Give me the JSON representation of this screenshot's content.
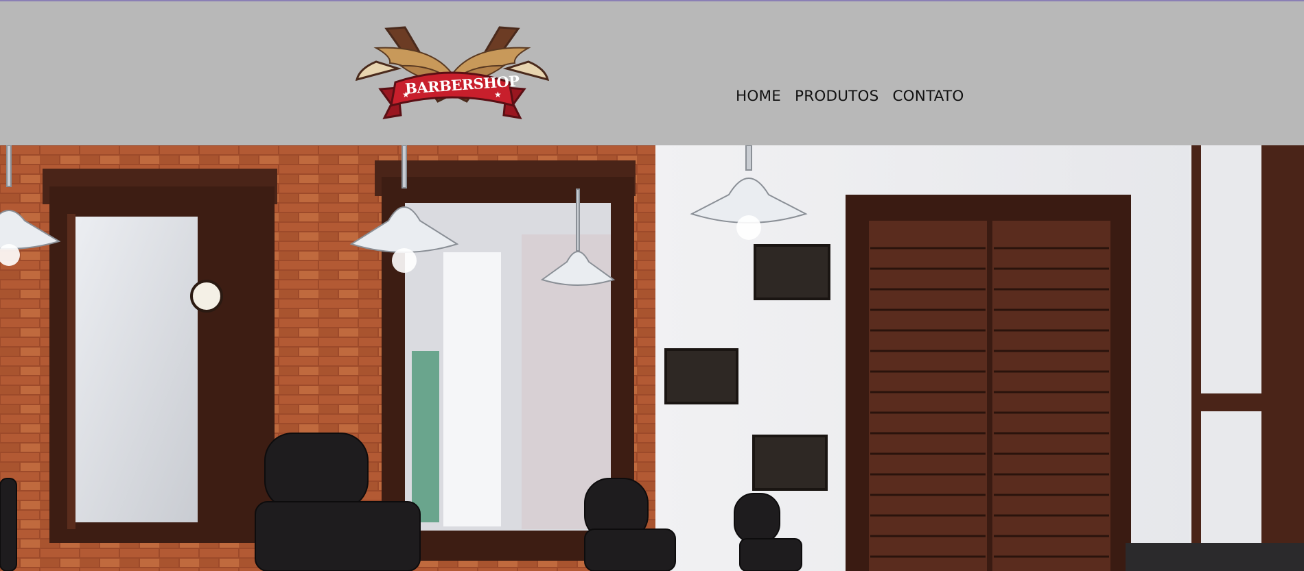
{
  "header": {
    "logo_text": "BARBERSHOP",
    "nav": [
      {
        "label": "HOME"
      },
      {
        "label": "PRODUTOS"
      },
      {
        "label": "CONTATO"
      }
    ]
  },
  "colors": {
    "header_bg": "#b8b8b8",
    "top_rule": "#8a7fb5",
    "logo_ribbon": "#c81f2c",
    "brick": "#a8512f",
    "wood": "#3f1f14"
  },
  "hero": {
    "icon": "barbershop-interior-photo"
  }
}
